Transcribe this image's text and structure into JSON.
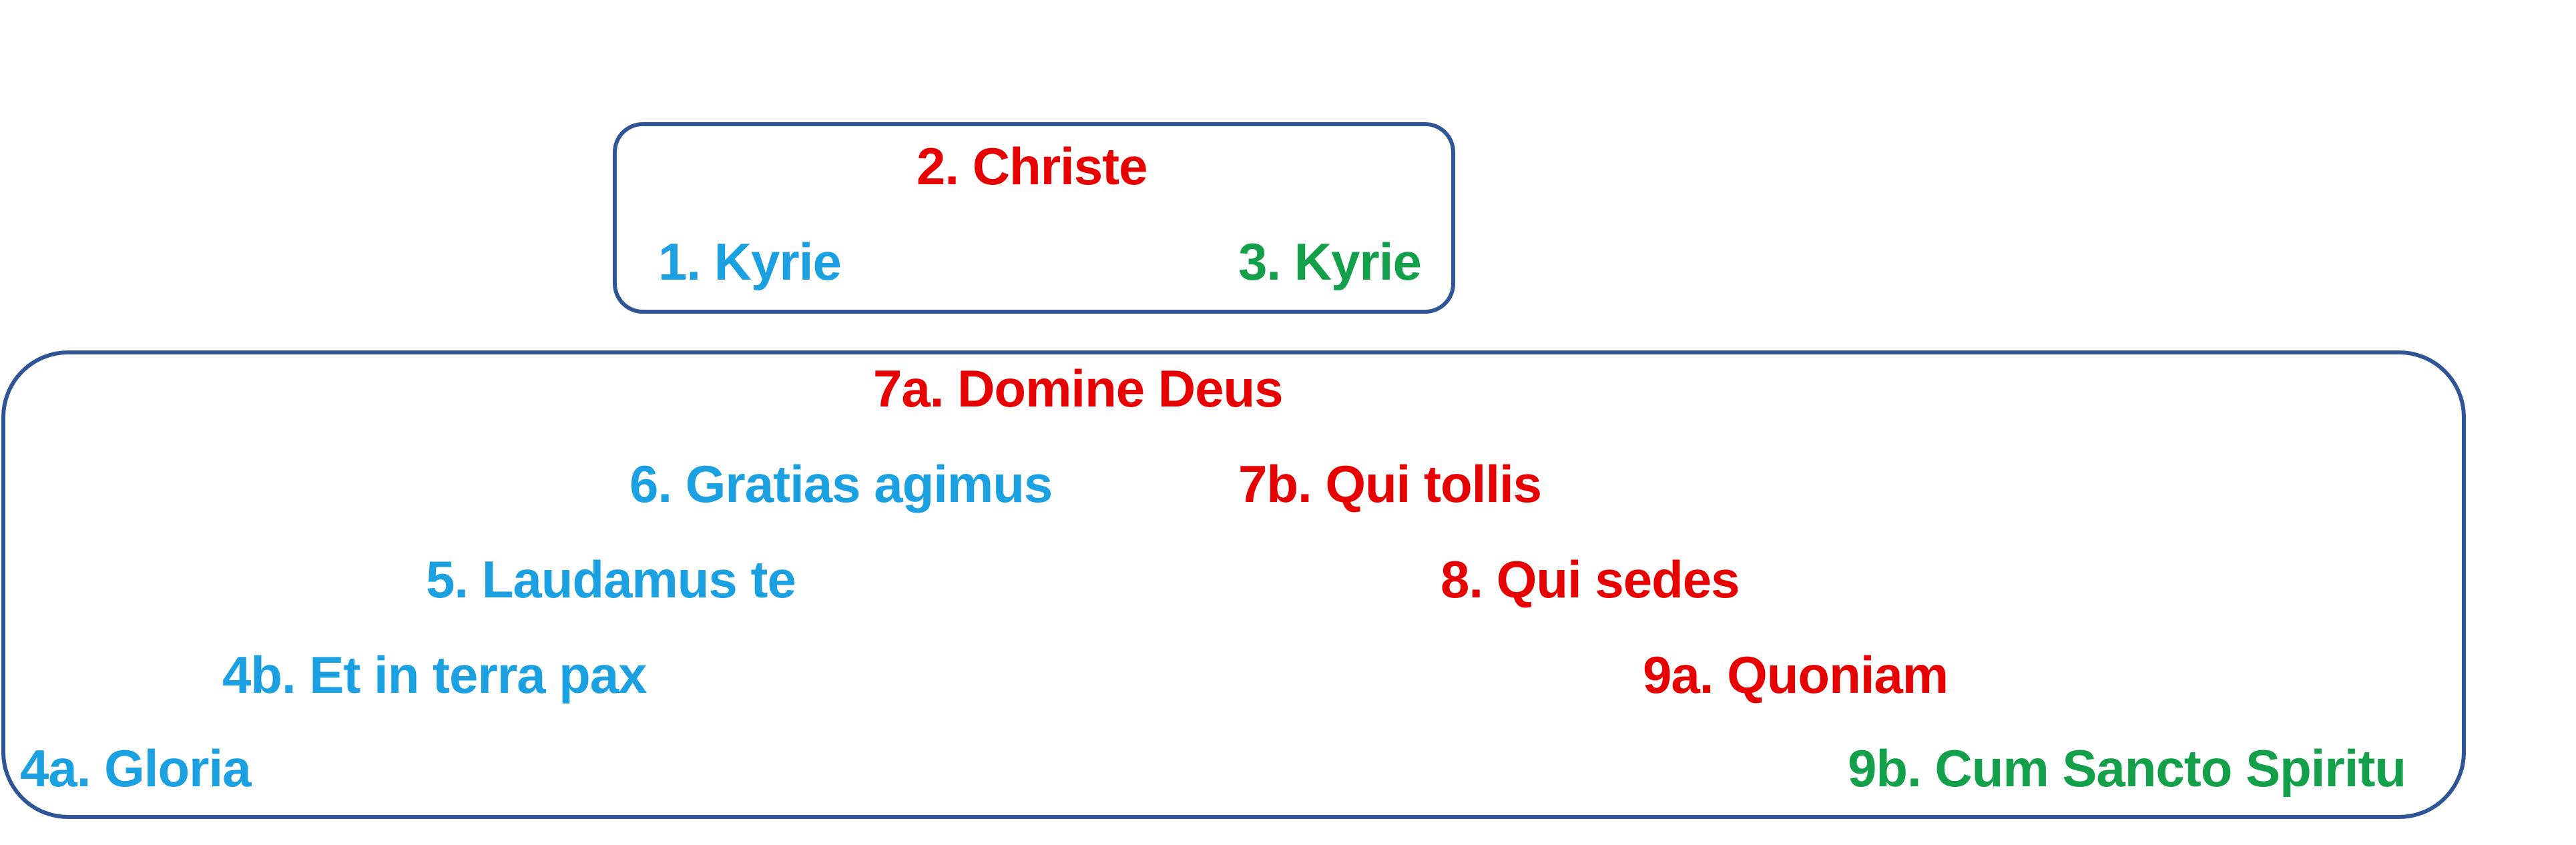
{
  "colors": {
    "box_border": "#2F5597",
    "blue": "#1BA1E2",
    "red": "#E60000",
    "green": "#14A04B"
  },
  "kyrie": {
    "christe": "2. Christe",
    "kyrie1": "1. Kyrie",
    "kyrie3": "3. Kyrie"
  },
  "gloria": {
    "domine_deus": "7a. Domine Deus",
    "gratias": "6. Gratias agimus",
    "qui_tollis": "7b. Qui tollis",
    "laudamus": "5. Laudamus te",
    "qui_sedes": "8. Qui sedes",
    "et_in_terra": "4b. Et in terra pax",
    "quoniam": "9a. Quoniam",
    "gloria": "4a. Gloria",
    "cum_sancto": "9b. Cum Sancto Spiritu"
  }
}
